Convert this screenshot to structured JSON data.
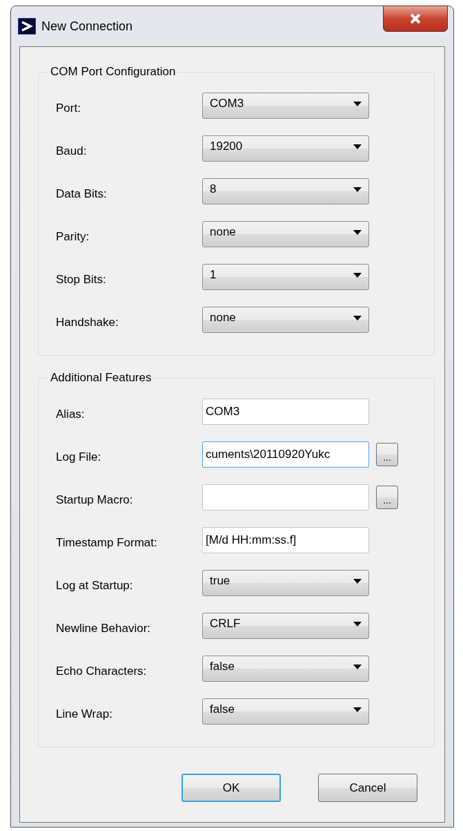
{
  "window": {
    "title": "New Connection"
  },
  "groups": [
    {
      "title": "COM Port Configuration",
      "fields": [
        {
          "label": "Port:",
          "kind": "combo",
          "value": "COM3"
        },
        {
          "label": "Baud:",
          "kind": "combo",
          "value": "19200"
        },
        {
          "label": "Data Bits:",
          "kind": "combo",
          "value": "8"
        },
        {
          "label": "Parity:",
          "kind": "combo",
          "value": "none"
        },
        {
          "label": "Stop Bits:",
          "kind": "combo",
          "value": "1"
        },
        {
          "label": "Handshake:",
          "kind": "combo",
          "value": "none"
        }
      ]
    },
    {
      "title": "Additional Features",
      "fields": [
        {
          "label": "Alias:",
          "kind": "text",
          "value": "COM3",
          "focused": false
        },
        {
          "label": "Log File:",
          "kind": "browse",
          "value": "cuments\\20110920Yukc",
          "focused": true,
          "browse": "..."
        },
        {
          "label": "Startup Macro:",
          "kind": "browse",
          "focused": false,
          "browse": "..."
        },
        {
          "label": "Timestamp Format:",
          "kind": "text",
          "value": "[M/d HH:mm:ss.f]",
          "focused": false
        },
        {
          "label": "Log at Startup:",
          "kind": "combo",
          "value": "true"
        },
        {
          "label": "Newline Behavior:",
          "kind": "combo",
          "value": "CRLF"
        },
        {
          "label": "Echo Characters:",
          "kind": "combo",
          "value": "false"
        },
        {
          "label": "Line Wrap:",
          "kind": "combo",
          "value": "false"
        }
      ]
    }
  ],
  "buttons": [
    {
      "label": "OK",
      "default": true
    },
    {
      "label": "Cancel",
      "default": false
    }
  ]
}
